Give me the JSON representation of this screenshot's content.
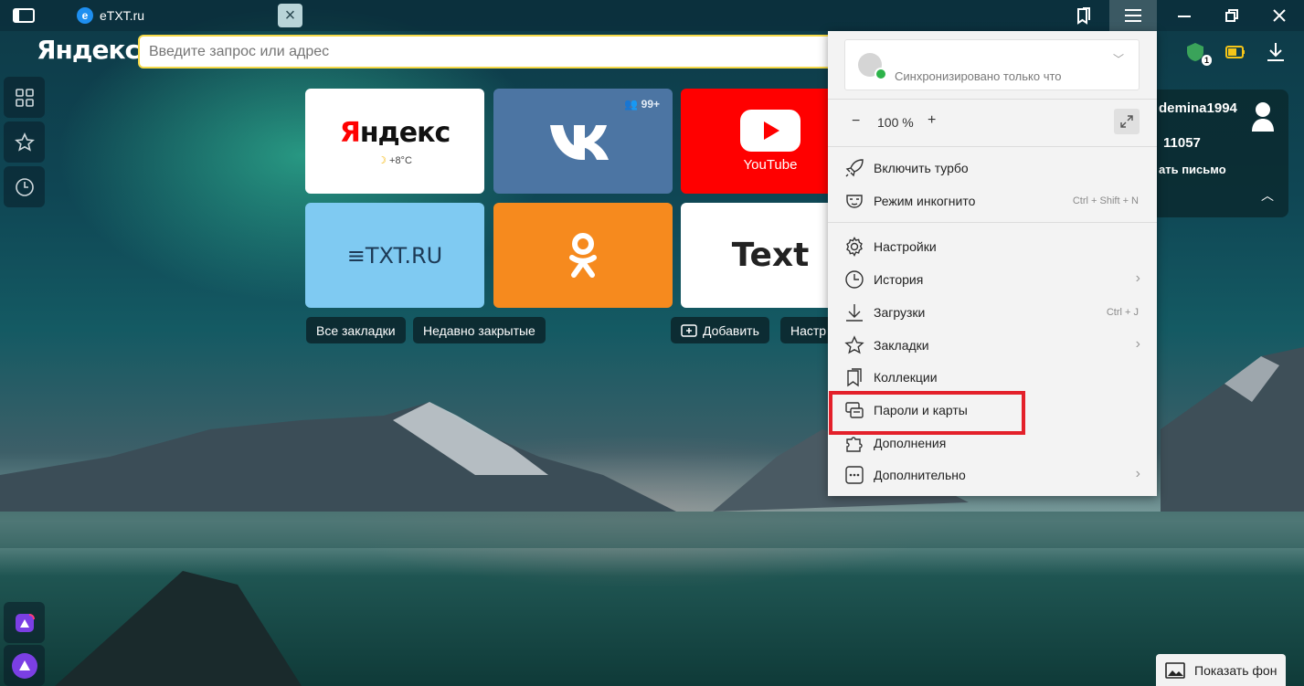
{
  "tabbar": {
    "tab_title": "eTXT.ru",
    "tab_favicon_letter": "e"
  },
  "header": {
    "logo": "Яндекс",
    "address_placeholder": "Введите запрос или адрес",
    "extension_badge": "1"
  },
  "tiles": {
    "yandex": {
      "logo_first": "Я",
      "logo_rest": "ндекс",
      "weather": "+8°C"
    },
    "vk": {
      "counter": "99+"
    },
    "youtube": {
      "label": "YouTube"
    },
    "etxt": {
      "logo": "TXT.RU"
    },
    "text": {
      "logo": "Text"
    }
  },
  "bookmarks_bar": {
    "all_bookmarks": "Все закладки",
    "recently_closed": "Недавно закрытые",
    "add": "Добавить",
    "settings_partial": "Настр"
  },
  "mail_widget": {
    "user": "demina1994",
    "count": "11057",
    "write": "ать письмо"
  },
  "menu": {
    "sync_status": "Синхронизировано только что",
    "zoom_minus": "−",
    "zoom_value": "100 %",
    "zoom_plus": "+",
    "items": [
      {
        "label": "Включить турбо",
        "icon": "rocket-icon"
      },
      {
        "label": "Режим инкогнито",
        "icon": "incognito-mask-icon",
        "shortcut": "Ctrl + Shift + N"
      },
      {
        "label": "Настройки",
        "icon": "gear-icon"
      },
      {
        "label": "История",
        "icon": "clock-icon",
        "submenu": true
      },
      {
        "label": "Загрузки",
        "icon": "download-icon",
        "shortcut": "Ctrl + J"
      },
      {
        "label": "Закладки",
        "icon": "star-icon",
        "submenu": true
      },
      {
        "label": "Коллекции",
        "icon": "collections-icon"
      },
      {
        "label": "Пароли и карты",
        "icon": "key-card-icon"
      },
      {
        "label": "Дополнения",
        "icon": "puzzle-icon"
      },
      {
        "label": "Дополнительно",
        "icon": "more-dots-icon",
        "submenu": true
      }
    ]
  },
  "footer": {
    "show_background": "Показать фон"
  },
  "colors": {
    "highlight": "#e3202a",
    "address_border": "#f5d948",
    "vk": "#4c75a3",
    "youtube": "#ff0000",
    "ok": "#f68a1e",
    "etxt": "#7fcaf2"
  }
}
